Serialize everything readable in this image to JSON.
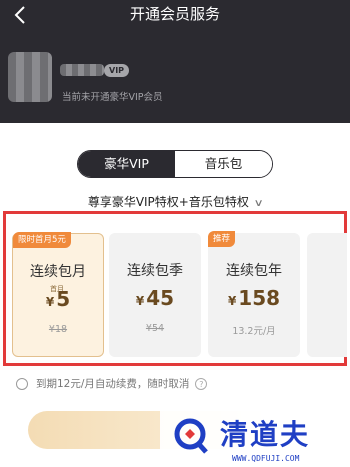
{
  "header": {
    "title": "开通会员服务",
    "vip_badge": "VIP",
    "status": "当前未开通豪华VIP会员"
  },
  "tabs": [
    {
      "label": "豪华VIP",
      "active": true
    },
    {
      "label": "音乐包",
      "active": false
    }
  ],
  "privilege_link": "尊享豪华VIP特权+音乐包特权",
  "plans": [
    {
      "tag": "限时首月5元",
      "name": "连续包月",
      "first_label": "首月",
      "price": "5",
      "sub": "¥18",
      "selected": true
    },
    {
      "tag": "",
      "name": "连续包季",
      "price": "45",
      "sub": "¥54",
      "selected": false
    },
    {
      "tag": "推荐",
      "name": "连续包年",
      "price": "158",
      "sub": "13.2元/月",
      "selected": false
    }
  ],
  "currency_symbol": "¥",
  "auto_renew": "到期12元/月自动续费，随时取消",
  "help_icon": "?",
  "watermark": {
    "text": "清道夫",
    "url": "WWW.QDFUJI.COM"
  },
  "colors": {
    "header_bg": "#2b2a30",
    "highlight_frame": "#e23a3a",
    "tag_bg": "#f08a3b",
    "price": "#6a4a20",
    "watermark": "#1f3fc4"
  }
}
